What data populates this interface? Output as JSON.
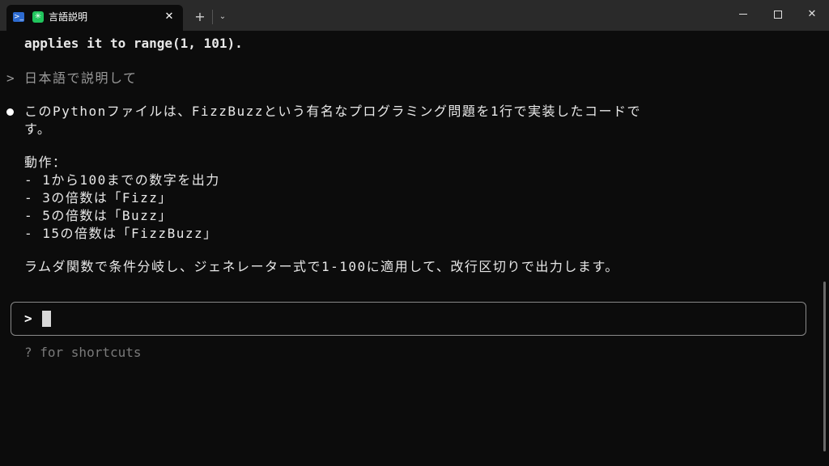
{
  "window": {
    "tab_title": "言語説明",
    "tab_close": "✕",
    "new_tab": "+",
    "dropdown": "⌄",
    "ps_glyph": ">_",
    "spark_glyph": "✳",
    "close_glyph": "✕"
  },
  "terminal": {
    "line_prev": "applies it to range(1, 101).",
    "prompt_symbol": ">",
    "user_query": "日本語で説明して",
    "answer_line1": "このPythonファイルは、FizzBuzzという有名なプログラミング問題を1行で実装したコードで",
    "answer_line2": "す。",
    "behavior_heading": "動作：",
    "behavior_items": [
      "- 1から100までの数字を出力",
      "- 3の倍数は「Fizz」",
      "- 5の倍数は「Buzz」",
      "- 15の倍数は「FizzBuzz」"
    ],
    "summary": "ラムダ関数で条件分岐し、ジェネレーター式で1-100に適用して、改行区切りで出力します。"
  },
  "input": {
    "prompt": ">",
    "value": ""
  },
  "hint": "? for shortcuts"
}
